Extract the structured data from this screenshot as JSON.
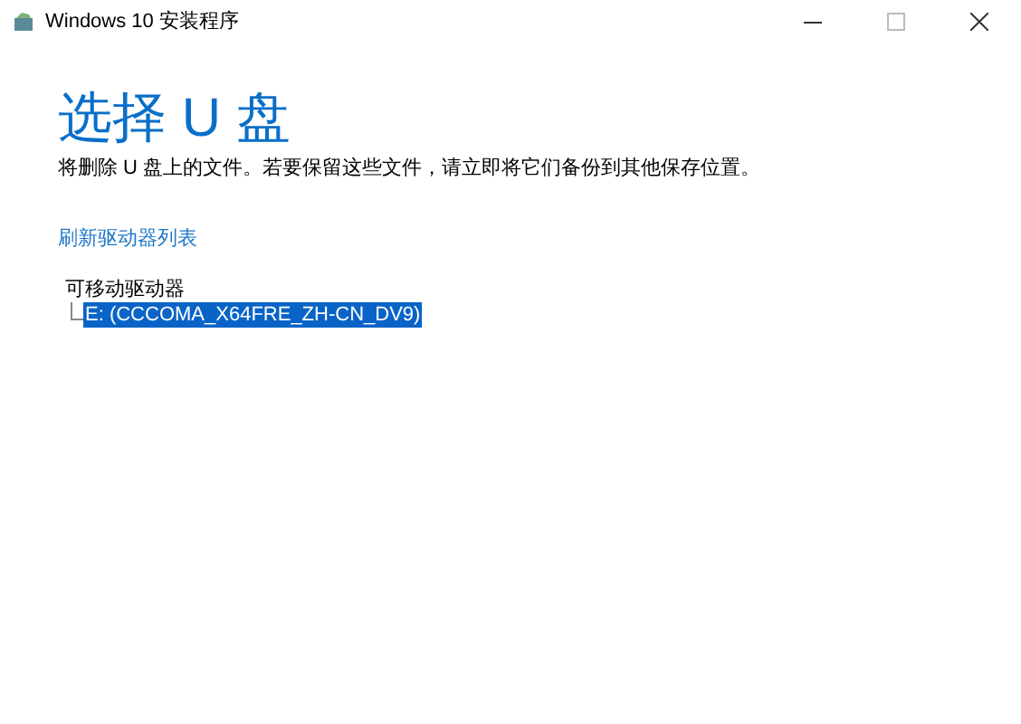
{
  "window": {
    "title": "Windows 10 安装程序"
  },
  "heading": "选择 U 盘",
  "description": "将删除 U 盘上的文件。若要保留这些文件，请立即将它们备份到其他保存位置。",
  "refresh_link": "刷新驱动器列表",
  "tree": {
    "label": "可移动驱动器",
    "children": [
      {
        "label": "E: (CCCOMA_X64FRE_ZH-CN_DV9)",
        "selected": true
      }
    ]
  }
}
